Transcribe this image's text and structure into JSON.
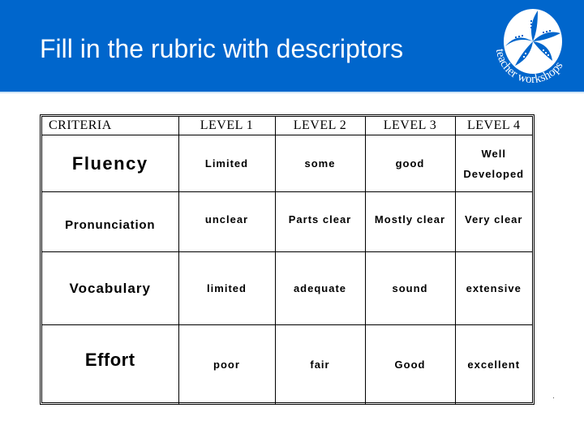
{
  "slide": {
    "title": "Fill in the rubric with descriptors",
    "logo": {
      "icon": "starfish-logo-icon",
      "text": "teacher workshops"
    },
    "colors": {
      "header_bg": "#0066cc",
      "title_text": "#ffffff"
    }
  },
  "rubric": {
    "headers": [
      "CRITERIA",
      "LEVEL 1",
      "LEVEL 2",
      "LEVEL 3",
      "LEVEL 4"
    ],
    "rows": [
      {
        "criterion": "Fluency",
        "levels": [
          "Limited",
          "some",
          "good",
          "Well Developed"
        ]
      },
      {
        "criterion": "Pronunciation",
        "levels": [
          "unclear",
          "Parts clear",
          "Mostly clear",
          "Very clear"
        ]
      },
      {
        "criterion": "Vocabulary",
        "levels": [
          "limited",
          "adequate",
          "sound",
          "extensive"
        ]
      },
      {
        "criterion": "Effort",
        "levels": [
          "poor",
          "fair",
          "Good",
          "excellent"
        ]
      }
    ]
  }
}
